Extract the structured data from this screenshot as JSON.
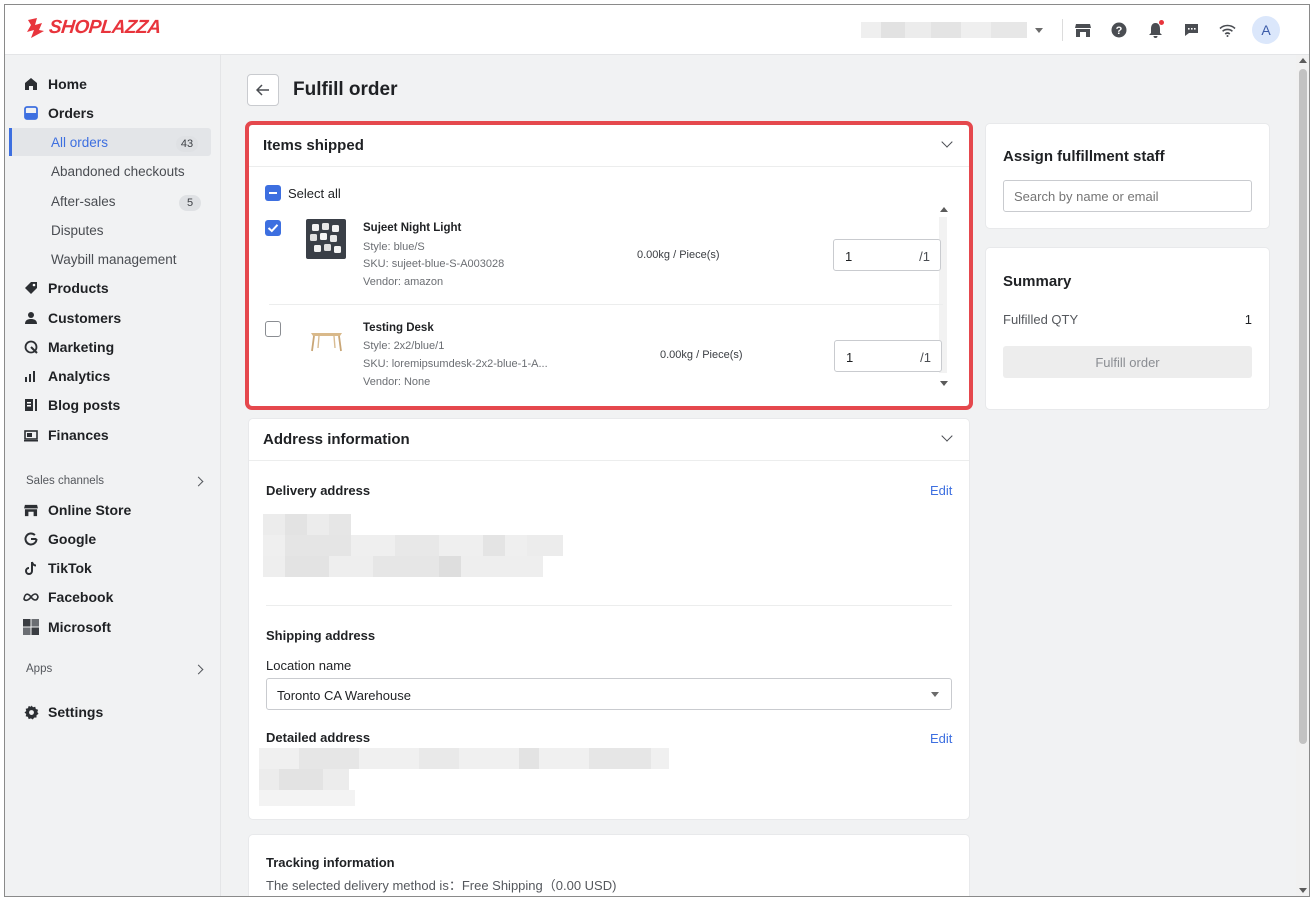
{
  "brand": {
    "name": "SHOPLAZZA",
    "color": "#e8343c"
  },
  "accent": "#3d6fe0",
  "header": {
    "icons": [
      "store-icon",
      "help-icon",
      "bell-icon",
      "chat-icon",
      "wifi-icon"
    ],
    "avatar_initial": "A"
  },
  "sidebar": {
    "nav": [
      {
        "label": "Home",
        "icon": "home-icon"
      },
      {
        "label": "Orders",
        "icon": "orders-icon"
      }
    ],
    "orders_sub": [
      {
        "label": "All orders",
        "badge": "43"
      },
      {
        "label": "Abandoned checkouts"
      },
      {
        "label": "After-sales",
        "badge": "5"
      },
      {
        "label": "Disputes"
      },
      {
        "label": "Waybill management"
      }
    ],
    "nav2": [
      {
        "label": "Products",
        "icon": "tag-icon"
      },
      {
        "label": "Customers",
        "icon": "person-icon"
      },
      {
        "label": "Marketing",
        "icon": "marketing-icon"
      },
      {
        "label": "Analytics",
        "icon": "bar-chart-icon"
      },
      {
        "label": "Blog posts",
        "icon": "blog-icon"
      },
      {
        "label": "Finances",
        "icon": "finance-icon"
      }
    ],
    "sales_channels_label": "Sales channels",
    "channels": [
      {
        "label": "Online Store",
        "icon": "store-icon"
      },
      {
        "label": "Google",
        "icon": "google-icon"
      },
      {
        "label": "TikTok",
        "icon": "tiktok-icon"
      },
      {
        "label": "Facebook",
        "icon": "meta-icon"
      },
      {
        "label": "Microsoft",
        "icon": "microsoft-icon"
      }
    ],
    "apps_label": "Apps",
    "settings_label": "Settings"
  },
  "page": {
    "title": "Fulfill order"
  },
  "items_card": {
    "title": "Items shipped",
    "select_all": "Select all",
    "items": [
      {
        "name": "Sujeet Night Light",
        "style": "Style: blue/S",
        "sku": "SKU: sujeet-blue-S-A003028",
        "vendor": "Vendor: amazon",
        "weight": "0.00kg / Piece(s)",
        "qty": "1",
        "max": "/1",
        "checked": true
      },
      {
        "name": "Testing Desk",
        "style": "Style: 2x2/blue/1",
        "sku": "SKU: loremipsumdesk-2x2-blue-1-A...",
        "vendor": "Vendor: None",
        "weight": "0.00kg / Piece(s)",
        "qty": "1",
        "max": "/1",
        "checked": false
      }
    ]
  },
  "address_card": {
    "title": "Address information",
    "delivery_label": "Delivery address",
    "edit": "Edit",
    "shipping_label": "Shipping address",
    "location_label": "Location name",
    "location_value": "Toronto CA Warehouse",
    "detailed_label": "Detailed address"
  },
  "tracking_card": {
    "title": "Tracking information",
    "method": "The selected delivery method is：Free Shipping（0.00 USD)"
  },
  "staff_card": {
    "title": "Assign fulfillment staff",
    "placeholder": "Search by name or email"
  },
  "summary_card": {
    "title": "Summary",
    "qty_label": "Fulfilled QTY",
    "qty_value": "1",
    "button": "Fulfill order"
  }
}
